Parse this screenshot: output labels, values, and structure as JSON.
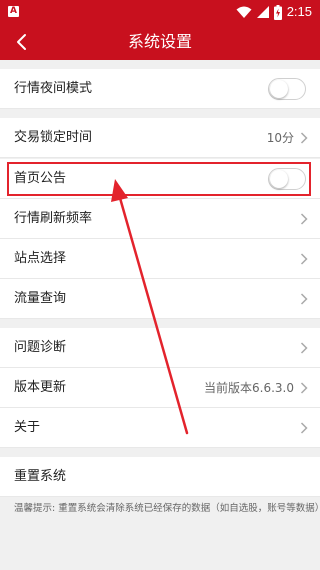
{
  "status_bar": {
    "app_badge": "A",
    "time": "2:15"
  },
  "header": {
    "title": "系统设置"
  },
  "settings": {
    "night_mode": {
      "label": "行情夜间模式",
      "enabled": false
    },
    "lock_time": {
      "label": "交易锁定时间",
      "value": "10分"
    },
    "homepage_notice": {
      "label": "首页公告",
      "enabled": false
    },
    "refresh_rate": {
      "label": "行情刷新频率"
    },
    "site_select": {
      "label": "站点选择"
    },
    "traffic": {
      "label": "流量查询"
    },
    "diagnosis": {
      "label": "问题诊断"
    },
    "version": {
      "label": "版本更新",
      "value": "当前版本6.6.3.0"
    },
    "about": {
      "label": "关于"
    },
    "reset": {
      "label": "重置系统"
    }
  },
  "hint": "温馨提示: 重置系统会清除系统已经保存的数据（如自选股，账号等数据）",
  "colors": {
    "brand_red": "#c8101e",
    "annotation_red": "#e3232c",
    "background": "#f0f0f0"
  }
}
